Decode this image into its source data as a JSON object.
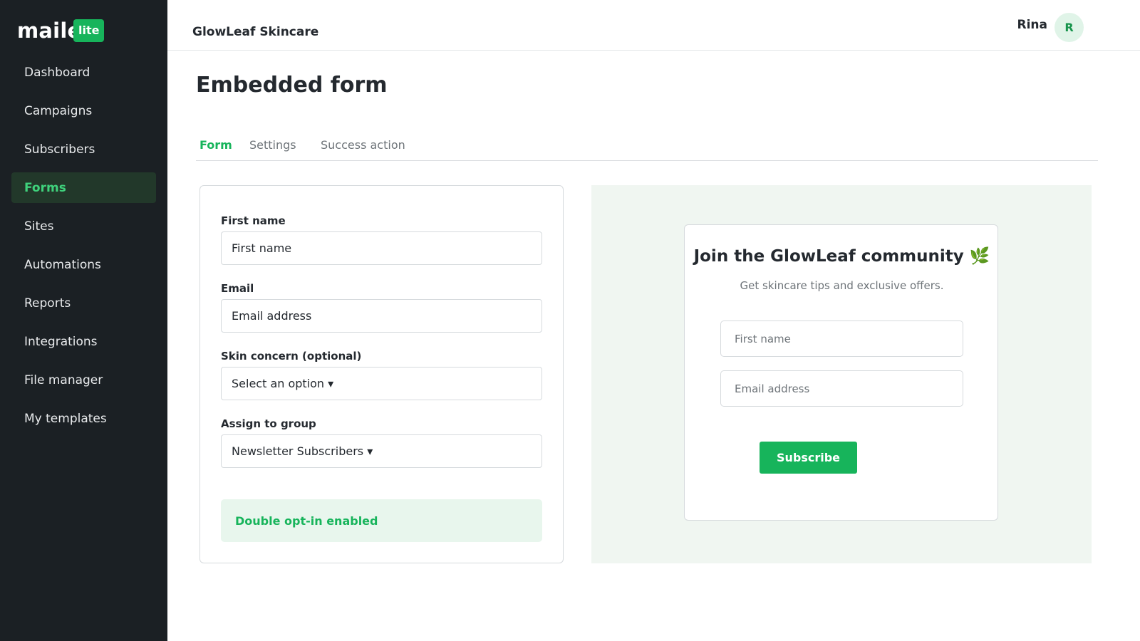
{
  "brand": {
    "logo_text": "mailerlite",
    "badge": "lite",
    "accent_color": "#17b45b",
    "sidebar_bg": "#1b2024"
  },
  "sidebar": {
    "items": [
      {
        "label": "Dashboard",
        "active": false
      },
      {
        "label": "Campaigns",
        "active": false
      },
      {
        "label": "Subscribers",
        "active": false
      },
      {
        "label": "Forms",
        "active": true
      },
      {
        "label": "Sites",
        "active": false
      },
      {
        "label": "Automations",
        "active": false
      },
      {
        "label": "Reports",
        "active": false
      },
      {
        "label": "Integrations",
        "active": false
      },
      {
        "label": "File manager",
        "active": false
      },
      {
        "label": "My templates",
        "active": false
      }
    ]
  },
  "header": {
    "org_name": "GlowLeaf Skincare",
    "user_name": "Rina",
    "avatar_initial": "R"
  },
  "page": {
    "title": "Embedded form"
  },
  "tabs": [
    {
      "label": "Form",
      "active": true
    },
    {
      "label": "Settings",
      "active": false
    },
    {
      "label": "Success action",
      "active": false
    }
  ],
  "editor": {
    "fields": [
      {
        "label": "First name",
        "value": "First name"
      },
      {
        "label": "Email",
        "value": "Email address"
      },
      {
        "label": "Skin concern (optional)",
        "value": "Select an option ▾"
      },
      {
        "label": "Assign to group",
        "value": "Newsletter Subscribers ▾"
      }
    ],
    "optin_notice": "Double opt-in enabled"
  },
  "preview": {
    "title": "Join the GlowLeaf community 🌿",
    "subtitle": "Get skincare tips and exclusive offers.",
    "first_name_placeholder": "First name",
    "email_placeholder": "Email address",
    "button_label": "Subscribe"
  }
}
